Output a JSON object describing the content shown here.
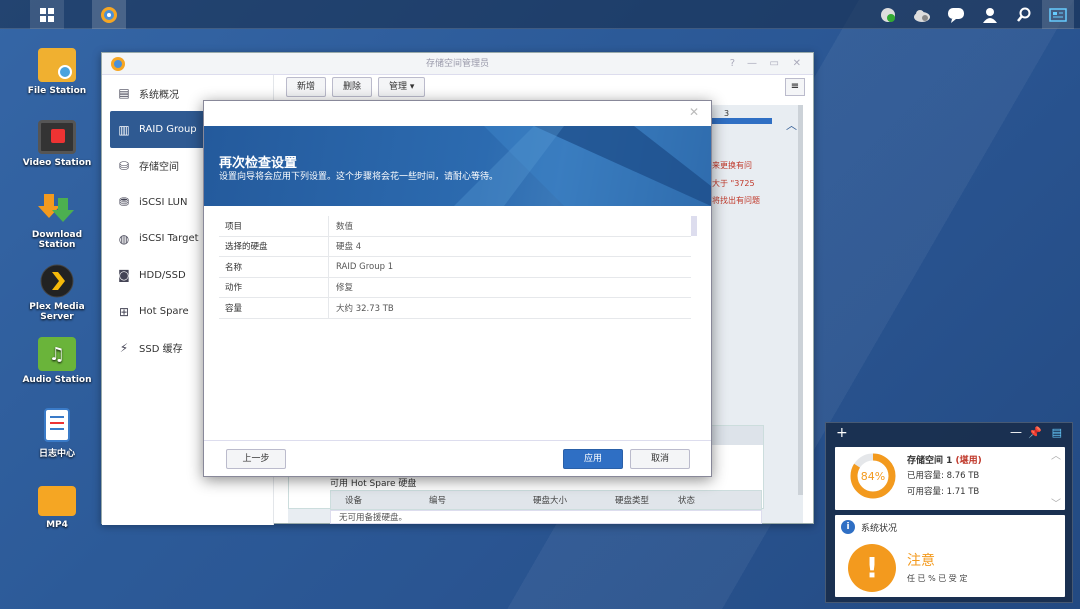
{
  "window": {
    "title": "存储空间管理员"
  },
  "sidebar": {
    "items": [
      {
        "label": "系统概况",
        "icon": "overview-icon"
      },
      {
        "label": "RAID Group",
        "icon": "raid-icon"
      },
      {
        "label": "存储空间",
        "icon": "storage-icon"
      },
      {
        "label": "iSCSI LUN",
        "icon": "lun-icon"
      },
      {
        "label": "iSCSI Target",
        "icon": "globe-icon"
      },
      {
        "label": "HDD/SSD",
        "icon": "hdd-icon"
      },
      {
        "label": "Hot Spare",
        "icon": "plus-icon"
      },
      {
        "label": "SSD 缓存",
        "icon": "cache-icon"
      }
    ]
  },
  "toolbar": {
    "create_label": "新增",
    "delete_label": "删除",
    "manage_label": "管理"
  },
  "background_text": {
    "line1": "来更换有问",
    "line2": "大于 \"3725",
    "line3": "将找出有问题",
    "num": "3"
  },
  "hotspare": {
    "label": "可用 Hot Spare 硬盘",
    "columns": [
      "设备",
      "编号",
      "硬盘大小",
      "硬盘类型",
      "状态"
    ],
    "empty": "无可用备援硬盘。"
  },
  "modal": {
    "title": "再次检查设置",
    "subtitle": "设置向导将会应用下列设置。这个步骤将会花一些时间，请耐心等待。",
    "table": {
      "header": [
        "项目",
        "数值"
      ],
      "rows": [
        [
          "选择的硬盘",
          "硬盘 4"
        ],
        [
          "名称",
          "RAID Group 1"
        ],
        [
          "动作",
          "修复"
        ],
        [
          "容量",
          "大约 32.73 TB"
        ]
      ]
    },
    "back_label": "上一步",
    "apply_label": "应用",
    "cancel_label": "取消"
  },
  "desktop": {
    "icons": [
      {
        "label": "File Station",
        "icon": "file-station-icon"
      },
      {
        "label": "Video Station",
        "icon": "video-station-icon"
      },
      {
        "label": "Download Station",
        "icon": "download-station-icon"
      },
      {
        "label": "Plex Media Server",
        "icon": "plex-icon"
      },
      {
        "label": "Audio Station",
        "icon": "audio-station-icon"
      },
      {
        "label": "日志中心",
        "icon": "log-center-icon"
      },
      {
        "label": "MP4",
        "icon": "folder-icon"
      }
    ]
  },
  "widget": {
    "storage": {
      "name": "存储空间 1",
      "status": "(堪用)",
      "used_label": "已用容量",
      "used": "8.76 TB",
      "avail_label": "可用容量",
      "avail": "1.71 TB",
      "percent": 0.84,
      "percent_label": "84%"
    },
    "system": {
      "title": "系统状况",
      "status": "注意",
      "tail_text": "任    已 % 已 受 定"
    }
  },
  "colors": {
    "accent": "#2f5a92",
    "orange": "#f39a1e",
    "apply": "#2f6fc4"
  }
}
